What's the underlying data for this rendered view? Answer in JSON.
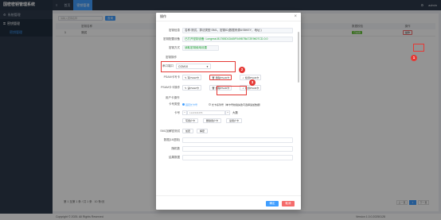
{
  "app": {
    "title": "国密密钥管理系统"
  },
  "sidebar": {
    "items": [
      {
        "label": "系统管理",
        "icon": "gear-icon"
      },
      {
        "label": "密钥管理",
        "icon": "key-icon"
      }
    ],
    "sub_items": [
      {
        "label": "密钥管理"
      }
    ]
  },
  "topbar": {
    "tabs": [
      {
        "label": "首页"
      },
      {
        "label": "密钥管理"
      }
    ],
    "right": {
      "settings": "⚙",
      "user": "admin"
    }
  },
  "main": {
    "search_placeholder": "请输入密钥名称",
    "search_button": "查询",
    "columns": [
      "",
      "密钥名称",
      "",
      "数据校验",
      "操作"
    ],
    "row": {
      "index": "1",
      "name": "测试",
      "type": "SM1",
      "key_id": "5E5D1DABF04987BA72E9607...",
      "status": "已启用",
      "op": "操作"
    }
  },
  "pager": {
    "summary": "第 1 至第 1 条 / 共 1 条",
    "page_size": "10 条/页",
    "pages": [
      "上一页",
      "1",
      "下一页"
    ]
  },
  "footer": {
    "copyright": "Copyright © 2025. All Rights Reserved",
    "version": "Version 1.0.0.20250128"
  },
  "modal": {
    "title": "操作",
    "fields": {
      "key_info": {
        "label": "密钥信息",
        "value": "名称:测试，算法类型:SM1，密钥ID(数据来源USBKEY，地址:)"
      },
      "device": {
        "label": "密钥配置设备",
        "value": "已打开密钥设备: Longmai-B1765D1DABF04987BA72E9607CD-0.0"
      },
      "method": {
        "label": "密钥方式",
        "value": "读取密钥使用设置"
      }
    },
    "section_device": "密钥操作",
    "port_label": "串口端口",
    "port_value": "COM10",
    "psam_write_label": "PSAM卡写卡",
    "psam_write_btns": [
      "写PSAM卡",
      "删除PSAM卡",
      "检测PSAM卡"
    ],
    "psam_read_label": "PSAM卡卡操作",
    "psam_read_btns": [
      "读PSAM卡",
      "删除PSAM卡",
      "检测PSAM卡"
    ],
    "user_section": "用户卡操作",
    "card_type_label": "卡号类型",
    "card_type_opts": [
      "固定长卡号",
      "长卡系列号（单卡号校验失败可选择追加数据）"
    ],
    "card_no_label": "卡号",
    "card_no_value": "1122334455",
    "card_extra": "大数",
    "user_btns": [
      "写用户卡",
      "删除用户卡",
      "读用户卡"
    ],
    "sm1_label": "SM1加解密测试",
    "sm1_opts": [
      "加密",
      "解密"
    ],
    "data_label": "数据(16进制)",
    "key_label": "随机数",
    "result_label": "结果数据",
    "confirm": "确定",
    "cancel": "取消"
  },
  "annotations": [
    "1",
    "2",
    "3"
  ]
}
